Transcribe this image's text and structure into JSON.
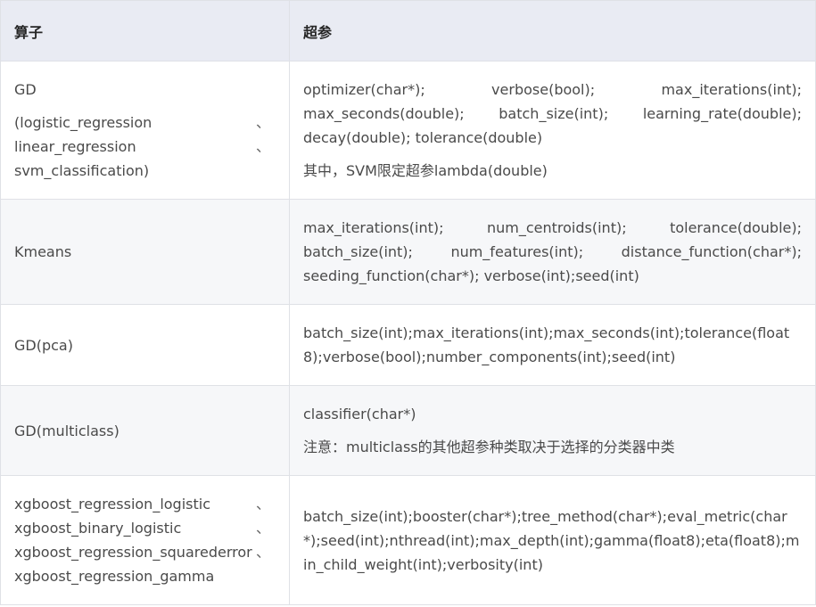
{
  "header": {
    "col_operator": "算子",
    "col_hyperparams": "超参"
  },
  "rows": [
    {
      "operator_title": "GD",
      "operator_items": [
        "(logistic_regression",
        "linear_regression",
        "svm_classification)"
      ],
      "operator_seps": [
        "、",
        "、",
        ""
      ],
      "params_lines": [
        "optimizer(char*); verbose(bool); max_iterations(int);",
        "max_seconds(double); batch_size(int); learning_rate(double);",
        "decay(double); tolerance(double)"
      ],
      "params_note": "其中，SVM限定超参lambda(double)"
    },
    {
      "operator_title": "Kmeans",
      "params_lines": [
        "max_iterations(int); num_centroids(int); tolerance(double);",
        "batch_size(int); num_features(int); distance_function(char*);",
        "seeding_function(char*); verbose(int);seed(int)"
      ]
    },
    {
      "operator_title": "GD(pca)",
      "params_text": "batch_size(int);max_iterations(int);max_seconds(int);tolerance(float8);verbose(bool);number_components(int);seed(int)"
    },
    {
      "operator_title": "GD(multiclass)",
      "params_text": "classifier(char*)",
      "params_note": "注意：multiclass的其他超参种类取决于选择的分类器中类"
    },
    {
      "operator_items": [
        "xgboost_regression_logistic",
        "xgboost_binary_logistic",
        "xgboost_regression_squarederror",
        "xgboost_regression_gamma"
      ],
      "operator_seps": [
        "、",
        "、",
        "、",
        ""
      ],
      "params_text": "batch_size(int);booster(char*);tree_method(char*);eval_metric(char*);seed(int);nthread(int);max_depth(int);gamma(float8);eta(float8);min_child_weight(int);verbosity(int)"
    }
  ]
}
